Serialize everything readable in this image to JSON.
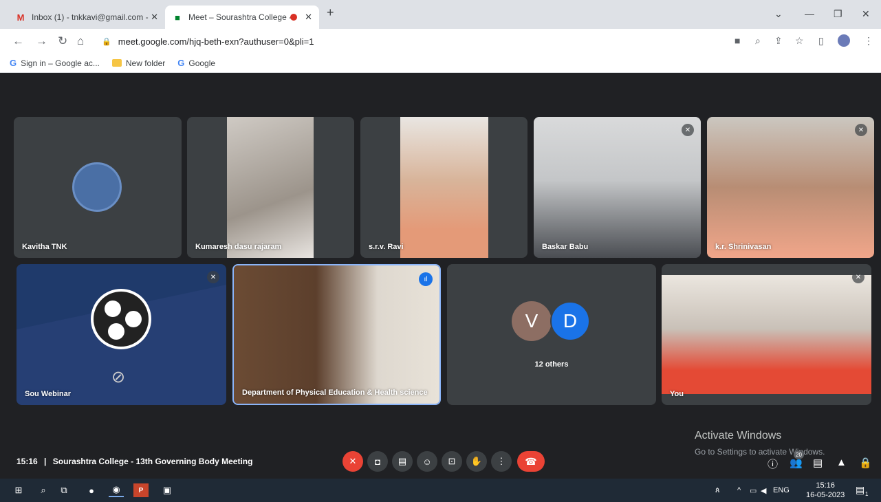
{
  "browser": {
    "tabs": [
      {
        "label": "Inbox (1) - tnkkavi@gmail.com -",
        "icon": "gmail-icon"
      },
      {
        "label": "Meet – Sourashtra College -",
        "icon": "meet-icon",
        "active": true
      }
    ],
    "url": "meet.google.com/hjq-beth-exn?authuser=0&pli=1",
    "bookmarks": [
      {
        "label": "Sign in – Google ac...",
        "icon": "google-icon"
      },
      {
        "label": "New folder",
        "icon": "folder-icon"
      },
      {
        "label": "Google",
        "icon": "google-icon"
      }
    ]
  },
  "meet": {
    "participants_row1": [
      {
        "name": "Kavitha TNK",
        "type": "avatar"
      },
      {
        "name": "Kumaresh dasu rajaram",
        "type": "video"
      },
      {
        "name": "s.r.v. Ravi",
        "type": "video"
      },
      {
        "name": "Baskar Babu",
        "type": "video",
        "muted": true
      },
      {
        "name": "k.r. Shrinivasan",
        "type": "video",
        "muted": true
      }
    ],
    "participants_row2": [
      {
        "name": "Sou Webinar",
        "type": "camera-off",
        "muted": true
      },
      {
        "name": "Department of Physical Education & Health science",
        "type": "video",
        "speaking": true
      },
      {
        "name": "12 others",
        "type": "group",
        "avatars": [
          "V",
          "D"
        ]
      },
      {
        "name": "You",
        "type": "video",
        "muted": true
      }
    ],
    "time": "15:16",
    "separator": "|",
    "meeting_title": "Sourashtra College - 13th Governing Body Meeting",
    "people_count": "20",
    "colors": {
      "accent": "#1a73e8",
      "danger": "#ea4335",
      "bg": "#202124",
      "tile": "#3c4043"
    }
  },
  "watermark": {
    "line1": "Activate Windows",
    "line2": "Go to Settings to activate Windows."
  },
  "taskbar": {
    "lang": "ENG",
    "time": "15:16",
    "date": "16-05-2023",
    "notification_count": "1"
  }
}
